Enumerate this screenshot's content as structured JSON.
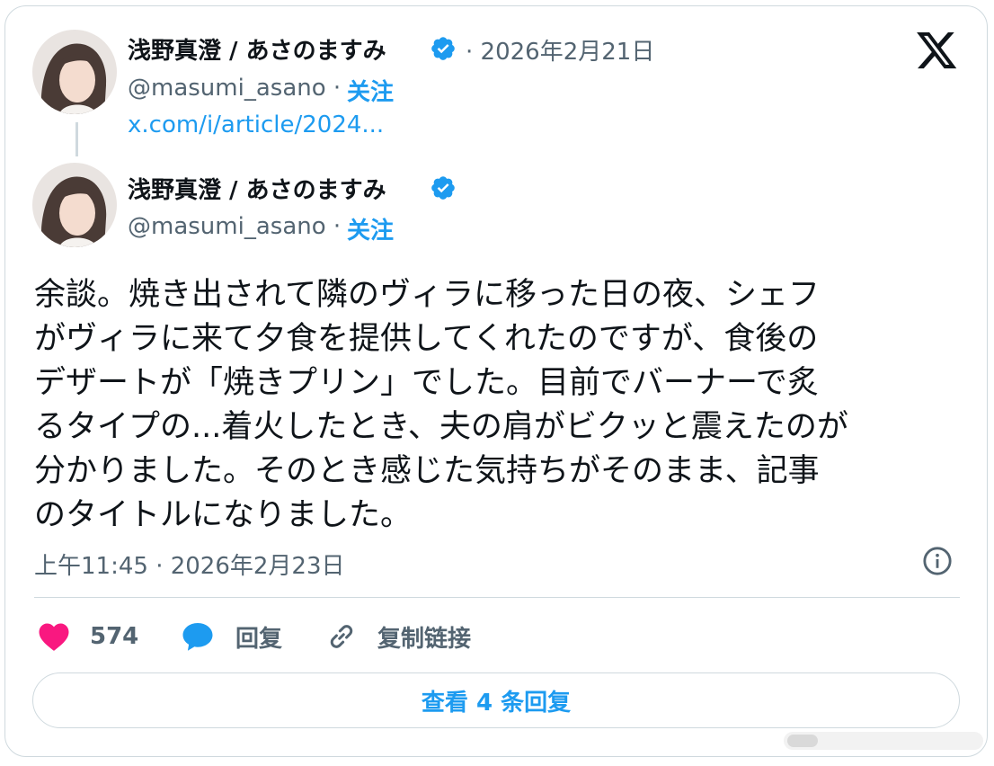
{
  "quoted_tweet": {
    "display_name": "浅野真澄 / あさのますみ",
    "verified": true,
    "date": "· 2026年2月21日",
    "handle": "@masumi_asano ·",
    "follow_label": "关注",
    "link_text": "x.com/i/article/2024..."
  },
  "main_tweet": {
    "display_name": "浅野真澄 / あさのますみ",
    "verified": true,
    "handle": "@masumi_asano ·",
    "follow_label": "关注",
    "text_lines": [
      "余談。焼き出されて隣のヴィラに移った日の夜、シェフ",
      "がヴィラに来て夕食を提供してくれたのですが、食後の",
      "デザートが「焼きプリン」でした。目前でバーナーで炙",
      "るタイプの...着火したとき、夫の肩がビクッと震えたのが",
      "分かりました。そのとき感じた気持ちがそのまま、記事",
      "のタイトルになりました。"
    ],
    "timestamp": "上午11:45 · 2026年2月23日"
  },
  "actions": {
    "like_count": "574",
    "reply_label": "回复",
    "copy_link_label": "复制链接"
  },
  "view_replies_label": "查看 4 条回复",
  "colors": {
    "accent": "#1d9bf0",
    "like": "#f91880",
    "text": "#0f1419",
    "secondary": "#536471",
    "border": "#cfd9de"
  },
  "icons": [
    "verified-badge-icon",
    "x-logo-icon",
    "info-icon",
    "heart-icon",
    "reply-bubble-icon",
    "link-icon"
  ]
}
